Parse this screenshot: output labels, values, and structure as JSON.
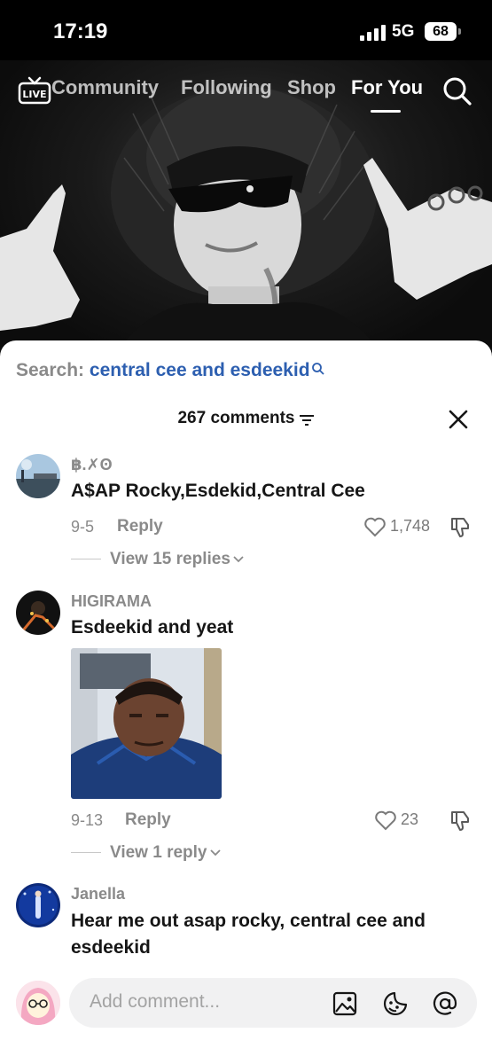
{
  "status_bar": {
    "time": "17:19",
    "network": "5G",
    "battery": "68"
  },
  "top_nav": {
    "live_label": "LIVE",
    "tabs": [
      {
        "label": "Community",
        "active": false
      },
      {
        "label": "Following",
        "active": false
      },
      {
        "label": "Shop",
        "active": false
      },
      {
        "label": "For You",
        "active": true
      }
    ]
  },
  "comments_sheet": {
    "search_prefix": "Search:",
    "search_query": "central cee and esdeekid",
    "comment_count_label": "267 comments",
    "comments": [
      {
        "username": "฿.✗ʘ",
        "text": "A$AP Rocky,Esdekid,Central Cee",
        "date": "9-5",
        "reply_label": "Reply",
        "likes": "1,748",
        "view_replies": "View 15 replies"
      },
      {
        "username": "HIGIRAMA",
        "text": "Esdeekid and yeat",
        "date": "9-13",
        "reply_label": "Reply",
        "likes": "23",
        "view_replies": "View 1 reply"
      },
      {
        "username": "Janella",
        "text": "Hear me out asap rocky, central cee and esdeekid"
      }
    ]
  },
  "composer": {
    "placeholder": "Add comment..."
  },
  "colors": {
    "link_blue": "#2d5fb0",
    "muted_gray": "#8a8a8a",
    "text_dark": "#161616",
    "input_bg": "#f1f1f2"
  },
  "icons": [
    "live-tv-icon",
    "search-icon",
    "sort-icon",
    "close-icon",
    "heart-icon",
    "dislike-icon",
    "chevron-down-icon",
    "image-icon",
    "sticker-icon",
    "mention-icon"
  ]
}
